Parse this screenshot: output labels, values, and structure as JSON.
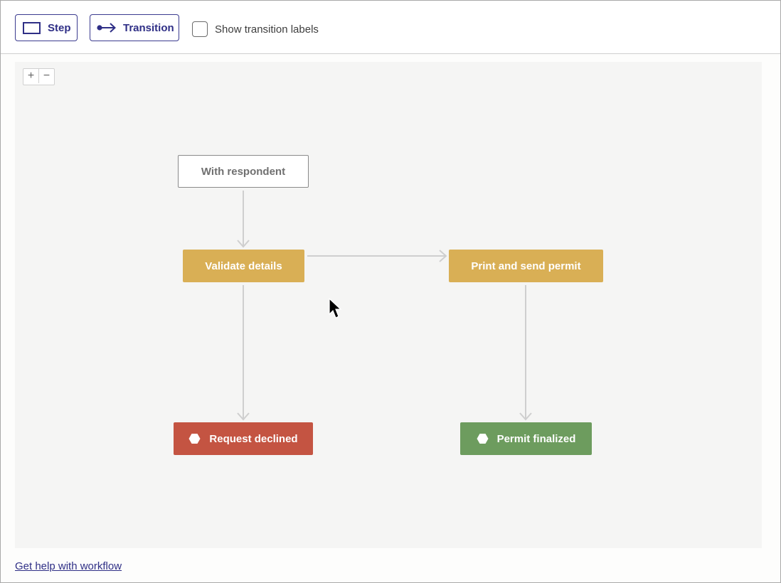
{
  "toolbar": {
    "step_label": "Step",
    "step_icon": "rectangle-icon",
    "transition_label": "Transition",
    "transition_icon": "arrow-connector-icon",
    "show_labels_text": "Show transition labels",
    "show_labels_checked": false
  },
  "zoom": {
    "in": "+",
    "out": "−"
  },
  "diagram": {
    "nodes": {
      "with_respondent": "With respondent",
      "validate_details": "Validate details",
      "print_send": "Print and send permit",
      "request_declined": "Request declined",
      "permit_finalized": "Permit finalized"
    },
    "edges": [
      {
        "from": "with_respondent",
        "to": "validate_details"
      },
      {
        "from": "validate_details",
        "to": "print_send"
      },
      {
        "from": "validate_details",
        "to": "request_declined"
      },
      {
        "from": "print_send",
        "to": "permit_finalized"
      }
    ],
    "colors": {
      "in_progress": "#d9af55",
      "declined": "#c45442",
      "finalized": "#6d9c5e",
      "edge": "#cfcfcf",
      "accent": "#2f2f86"
    }
  },
  "footer": {
    "help_link": "Get help with workflow"
  }
}
